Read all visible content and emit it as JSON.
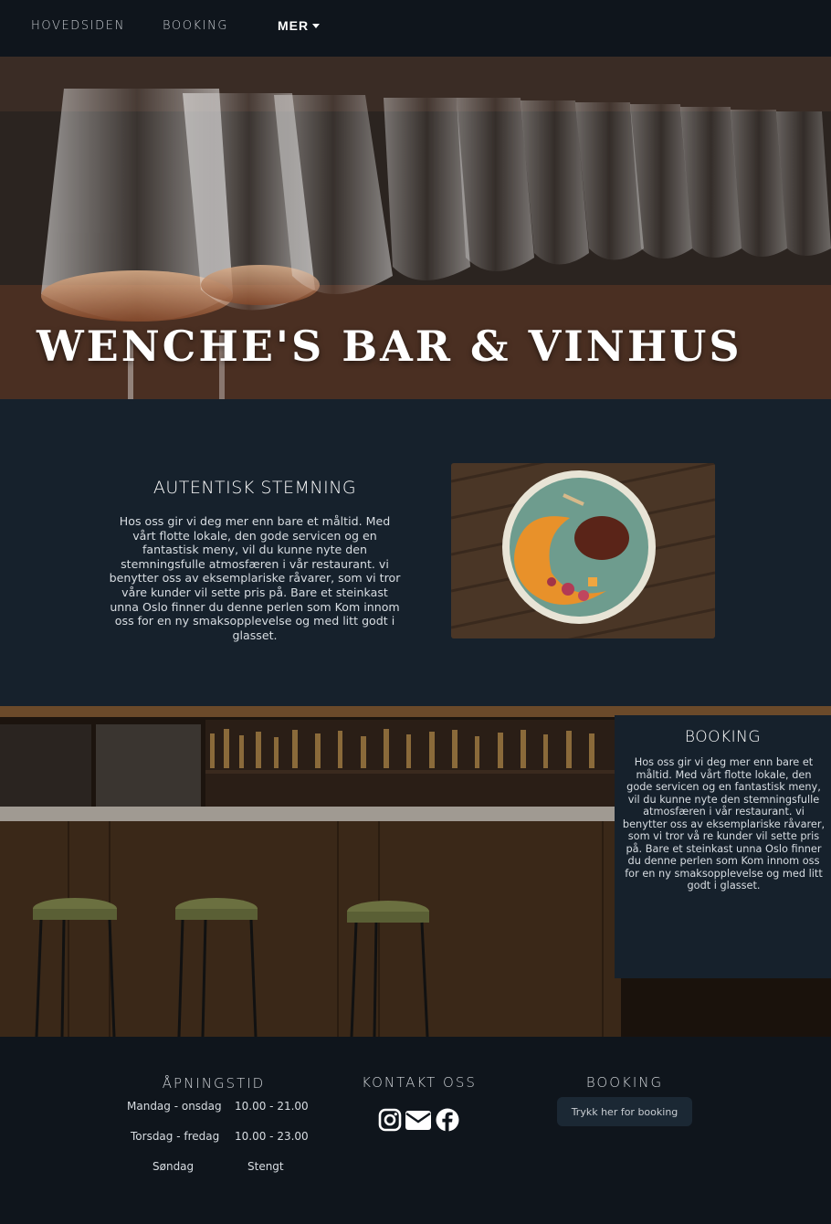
{
  "nav": {
    "home": "HOVEDSIDEN",
    "booking": "BOOKING",
    "more": "MER"
  },
  "hero": {
    "title": "WENCHE'S BAR & VINHUS"
  },
  "intro": {
    "heading": "AUTENTISK STEMNING",
    "text": "Hos oss gir vi deg mer enn bare et måltid. Med vårt flotte lokale, den gode servicen og en fantastisk meny, vil du kunne nyte den stemningsfulle atmosfæren i vår restaurant. vi benytter oss av eksemplariske råvarer, som vi tror våre kunder vil sette pris på. Bare et steinkast unna Oslo finner du denne perlen som Kom innom oss for en ny smaksopplevelse og med litt godt i glasset."
  },
  "booking_panel": {
    "heading": "BOOKING",
    "text": "Hos oss gir vi deg mer enn bare et måltid. Med vårt flotte lokale, den gode servicen og en fantastisk meny, vil du kunne nyte den stemningsfulle atmosfæren i vår restaurant. vi benytter oss av eksemplariske råvarer, som vi tror vå re kunder vil sette pris på. Bare et steinkast unna Oslo finner du denne perlen som Kom innom oss for en ny smaksopplevelse og med litt godt i glasset."
  },
  "footer": {
    "hours_heading": "ÅPNINGSTID",
    "hours": [
      {
        "day": "Mandag - onsdag",
        "time": "10.00 - 21.00"
      },
      {
        "day": "Torsdag - fredag",
        "time": "10.00 - 23.00"
      },
      {
        "day": "Søndag",
        "time": "Stengt"
      }
    ],
    "contact_heading": "KONTAKT OSS",
    "contact_icons": [
      "instagram-icon",
      "envelope-icon",
      "facebook-icon"
    ],
    "booking_heading": "BOOKING",
    "booking_button": "Trykk her for booking"
  },
  "colors": {
    "page_bg": "#16212c",
    "nav_bg": "#0f151c",
    "footer_bg": "#0f151c",
    "button_bg": "#1b2834"
  }
}
